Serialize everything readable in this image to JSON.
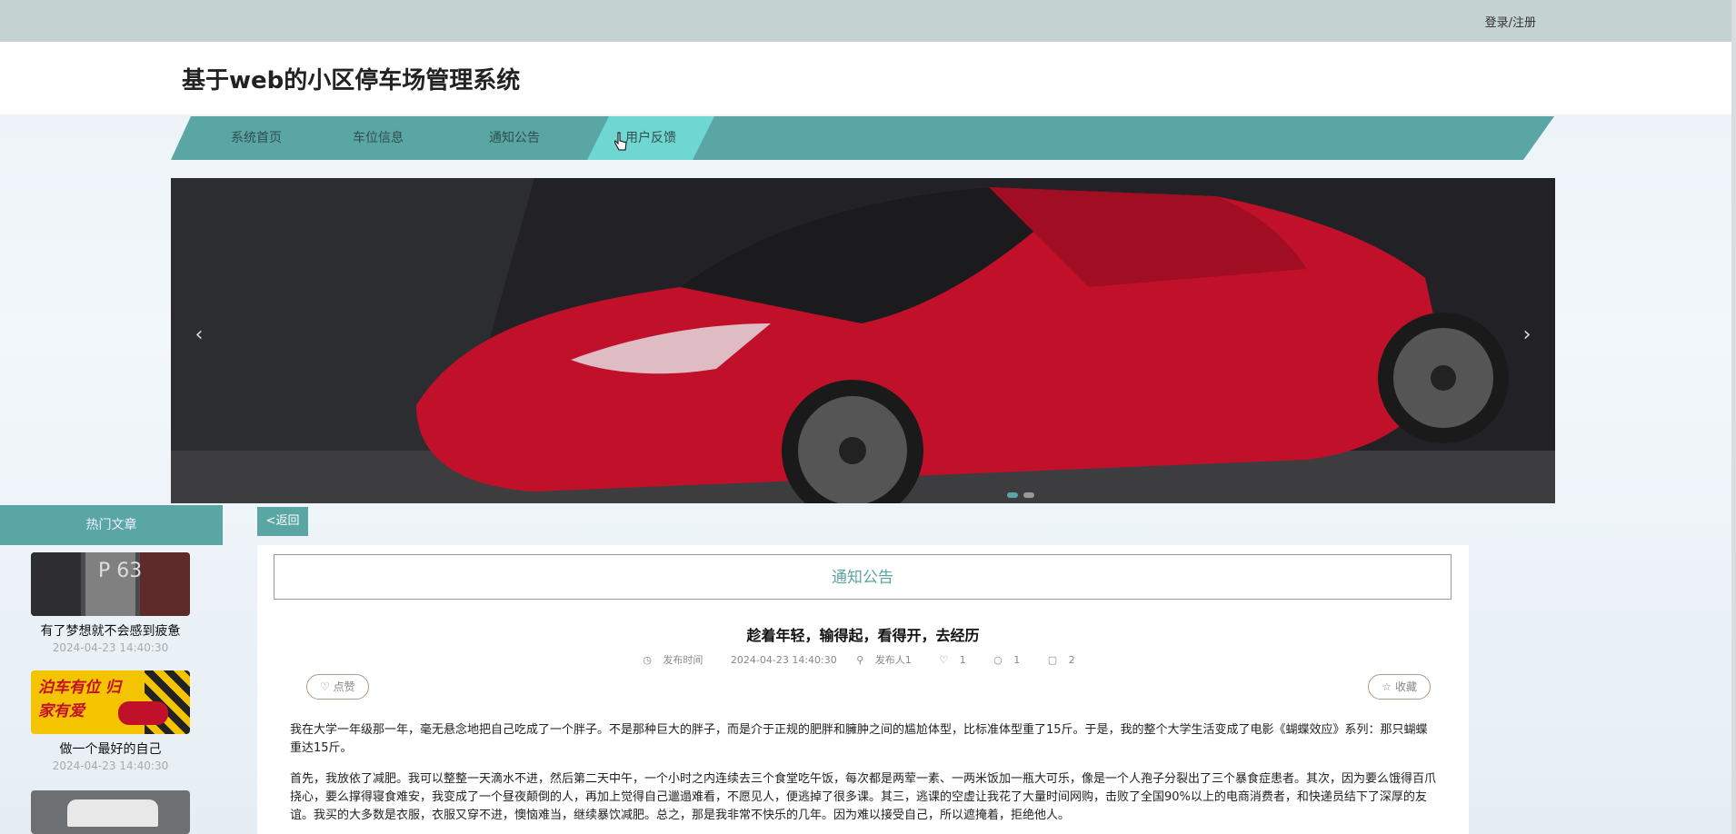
{
  "topbar": {
    "login_label": "登录/注册"
  },
  "header": {
    "title": "基于web的小区停车场管理系统"
  },
  "nav": {
    "items": [
      {
        "label": "系统首页"
      },
      {
        "label": "车位信息"
      },
      {
        "label": "通知公告"
      },
      {
        "label": "用户反馈"
      }
    ]
  },
  "carousel": {
    "prev": "‹",
    "next": "›"
  },
  "sidebar": {
    "heading": "热门文章",
    "articles": [
      {
        "title": "有了梦想就不会感到疲惫",
        "date": "2024-04-23 14:40:30",
        "thumb_text": "P 63"
      },
      {
        "title": "做一个最好的自己",
        "date": "2024-04-23 14:40:30",
        "thumb_text": "泊车有位 归家有爱"
      }
    ]
  },
  "content": {
    "back_label": "<返回",
    "section_title": "通知公告",
    "post_title": "趁着年轻，输得起，看得开，去经历",
    "meta": {
      "time_label": "发布时间",
      "time": "2024-04-23 14:40:30",
      "author": "发布人1",
      "likes": "1",
      "dislikes": "1",
      "comments": "2"
    },
    "like_label": "点赞",
    "collect_label": "收藏",
    "paragraphs": [
      "我在大学一年级那一年，毫无悬念地把自己吃成了一个胖子。不是那种巨大的胖子，而是介于正规的肥胖和臃肿之间的尴尬体型，比标准体型重了15斤。于是，我的整个大学生活变成了电影《蝴蝶效应》系列：那只蝴蝶重达15斤。",
      "首先，我放依了减肥。我可以整整一天滴水不进，然后第二天中午，一个小时之内连续去三个食堂吃午饭，每次都是两荤一素、一两米饭加一瓶大可乐，像是一个人孢子分裂出了三个暴食症患者。其次，因为要么饿得百爪挠心，要么撑得寝食难安，我变成了一个昼夜颠倒的人，再加上觉得自己邋遢难看，不愿见人，便逃掉了很多课。其三，逃课的空虚让我花了大量时间网购，击败了全国90%以上的电商消费者，和快递员结下了深厚的友谊。我买的大多数是衣服，衣服又穿不进，懊恼难当，继续暴饮减肥。总之，那是我非常不快乐的几年。因为难以接受自己，所以遮掩着，拒绝他人。"
    ]
  },
  "colors": {
    "accent": "#5aa6a4",
    "active_tab": "#6fd6d2",
    "topbar": "#c4d3cf"
  }
}
